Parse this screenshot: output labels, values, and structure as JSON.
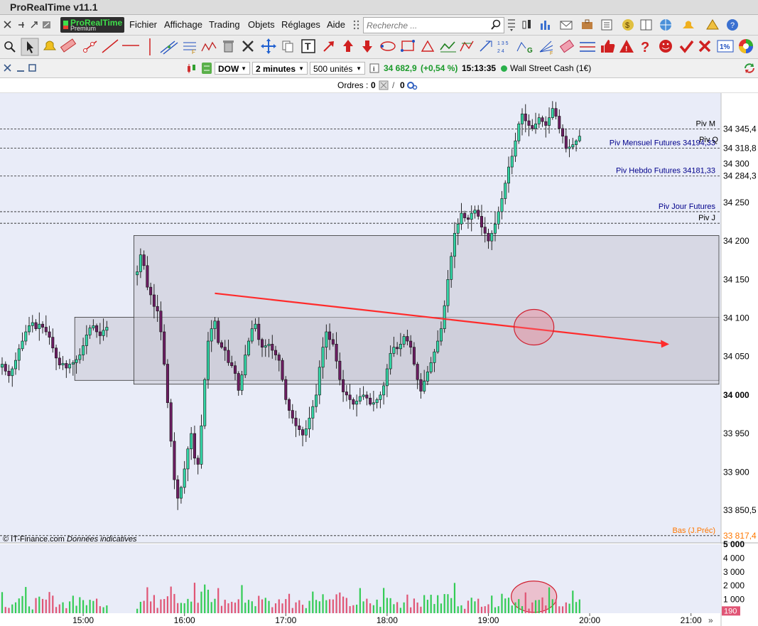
{
  "app": {
    "title": "ProRealTime v11.1",
    "logo_main": "ProRealTime",
    "logo_sub": "Premium"
  },
  "menu": {
    "items": [
      "Fichier",
      "Affichage",
      "Trading",
      "Objets",
      "Réglages",
      "Aide"
    ]
  },
  "search": {
    "placeholder": "Recherche ..."
  },
  "chart_toolbar": {
    "instrument": "DOW",
    "timeframe": "2 minutes",
    "units": "500 unités",
    "price": "34 682,9",
    "change": "(+0,54 %)",
    "time": "15:13:35",
    "name": "Wall Street Cash (1€)"
  },
  "orders": {
    "label": "Ordres :",
    "value1": "0",
    "value2": "0"
  },
  "colors": {
    "bull": "#33d6a6",
    "bear": "#6d1d63",
    "trend": "#ff2b2b",
    "volume_up": "#33cc55",
    "volume_down": "#e05575",
    "zone": "#c9c9d3",
    "background": "#e9ecf8"
  },
  "chart_data": {
    "type": "candlestick",
    "title": "",
    "x_ticks": [
      "15:00",
      "16:00",
      "17:00",
      "18:00",
      "19:00",
      "20:00",
      "21:00"
    ],
    "y_ticks": [
      "34 300",
      "34 250",
      "34 200",
      "34 150",
      "34 100",
      "34 050",
      "34 000",
      "33 950",
      "33 900"
    ],
    "ylim": [
      33808,
      34392
    ],
    "levels": [
      {
        "label": "Piv M",
        "value": 34345.4,
        "tag": "34 345,4",
        "color": "#000000"
      },
      {
        "label": "Piv Mensuel Futures 34194,33",
        "value": 34320.5,
        "tag": "34 318,8",
        "color": "#00008b"
      },
      {
        "label": "Piv Hebdo Futures 34181,33",
        "value": 34284.3,
        "tag": "34 284,3",
        "color": "#00008b"
      },
      {
        "label": "Piv Jour Futures",
        "value": 34238,
        "tag": "",
        "color": "#00008b"
      },
      {
        "label": "Piv J",
        "value": 34223,
        "tag": "",
        "color": "#000000"
      },
      {
        "label": "Bas (J.Préc)",
        "value": 33817.4,
        "tag": "33 817,4",
        "color": "#ff7700"
      }
    ],
    "low_tag": "33 850,5",
    "low_value": 33850.5,
    "current_label": "Piv Q",
    "zones": [
      {
        "from": "14:55",
        "to": "21:20",
        "top": 34101,
        "bottom": 34019
      },
      {
        "from": "15:30",
        "to": "21:20",
        "top": 34207,
        "bottom": 34014
      }
    ],
    "trendline": {
      "start": {
        "time": "16:18",
        "price": 34132
      },
      "end": {
        "time": "21:20",
        "price": 34066
      }
    },
    "highlight": {
      "time": "19:27",
      "price": 34088
    },
    "volume_highlight": {
      "time": "19:27",
      "volume": 1200
    },
    "source": {
      "provider": "© IT-Finance.com",
      "note": "Données indicatives"
    },
    "volume": {
      "y_ticks": [
        "5 000",
        "4 000",
        "3 000",
        "2 000",
        "1 000"
      ],
      "ylim": [
        0,
        5000
      ],
      "current_tag": "190",
      "current_value": 190
    },
    "segments": [
      {
        "start": "14:12",
        "step_min": 2,
        "closes": [
          34040,
          34031,
          34025,
          34034,
          34045,
          34060,
          34070,
          34082,
          34090,
          34094,
          34086,
          34092,
          34088,
          34082,
          34075,
          34061,
          34048,
          34039,
          34041,
          34035,
          34040,
          34042,
          34046,
          34052,
          34064,
          34078,
          34087,
          34090,
          34082,
          34077,
          34084,
          34088
        ]
      },
      {
        "start": "15:32",
        "step_min": 2,
        "closes": [
          34160,
          34182,
          34168,
          34140,
          34130,
          34115,
          34109,
          34082,
          34040,
          33990,
          33940,
          33890,
          33866,
          33880,
          33904,
          33930,
          33950,
          33918,
          33910,
          33960,
          34020,
          34070,
          34086,
          34096,
          34068,
          34062,
          34058,
          34042,
          34038,
          34028,
          34006,
          34026,
          34052,
          34070,
          34086,
          34092,
          34072,
          34062,
          34064,
          34066,
          34058,
          34052,
          34045,
          34020,
          33994,
          33980,
          33970,
          33960,
          33955,
          33948,
          33956,
          33970,
          33985,
          34000,
          34036,
          34062,
          34082,
          34072,
          34066,
          34044,
          34020,
          34004,
          34000,
          33994,
          33988,
          33992,
          33998,
          34000,
          33996,
          33988,
          33990,
          33994,
          34000,
          34012,
          34034,
          34054,
          34062,
          34060,
          34066,
          34076,
          34070,
          34062,
          34040,
          34020,
          34005,
          34018,
          34030,
          34042,
          34056,
          34070,
          34086,
          34116,
          34150,
          34180,
          34210,
          34222,
          34236,
          34230,
          34228,
          34236,
          34240,
          34232,
          34218,
          34210,
          34200,
          34210,
          34222,
          34238,
          34255,
          34275,
          34296,
          34310,
          34330,
          34352,
          34365,
          34356,
          34350,
          34346,
          34352,
          34360,
          34355,
          34350,
          34360,
          34372,
          34362,
          34346,
          34336,
          34320,
          34322,
          34325,
          34330,
          34336
        ]
      }
    ]
  }
}
